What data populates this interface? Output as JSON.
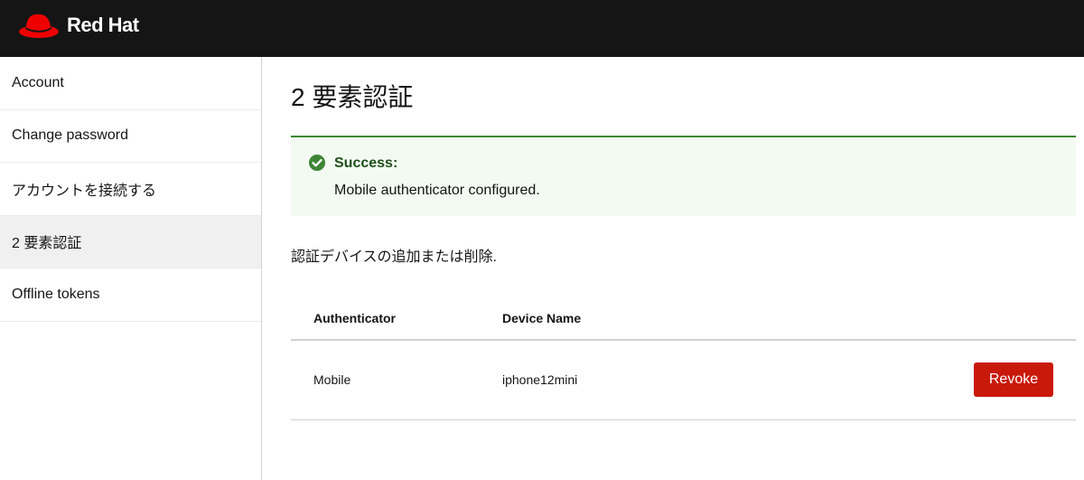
{
  "header": {
    "brand": "Red Hat",
    "brand_color": "#ee0000",
    "logo_icon": "red-hat-fedora-icon"
  },
  "sidebar": {
    "items": [
      {
        "label": "Account",
        "active": false
      },
      {
        "label": "Change password",
        "active": false
      },
      {
        "label": "アカウントを接続する",
        "active": false
      },
      {
        "label": "2 要素認証",
        "active": true
      },
      {
        "label": "Offline tokens",
        "active": false
      }
    ]
  },
  "main": {
    "title": "2 要素認証",
    "alert": {
      "icon": "check-circle-icon",
      "title": "Success:",
      "message": "Mobile authenticator configured.",
      "color": "#3e8635"
    },
    "instructions": "認証デバイスの追加または削除.",
    "table": {
      "headers": [
        "Authenticator",
        "Device Name"
      ],
      "rows": [
        {
          "authenticator": "Mobile",
          "device_name": "iphone12mini",
          "action": "Revoke"
        }
      ]
    },
    "revoke_color": "#c9190b"
  }
}
